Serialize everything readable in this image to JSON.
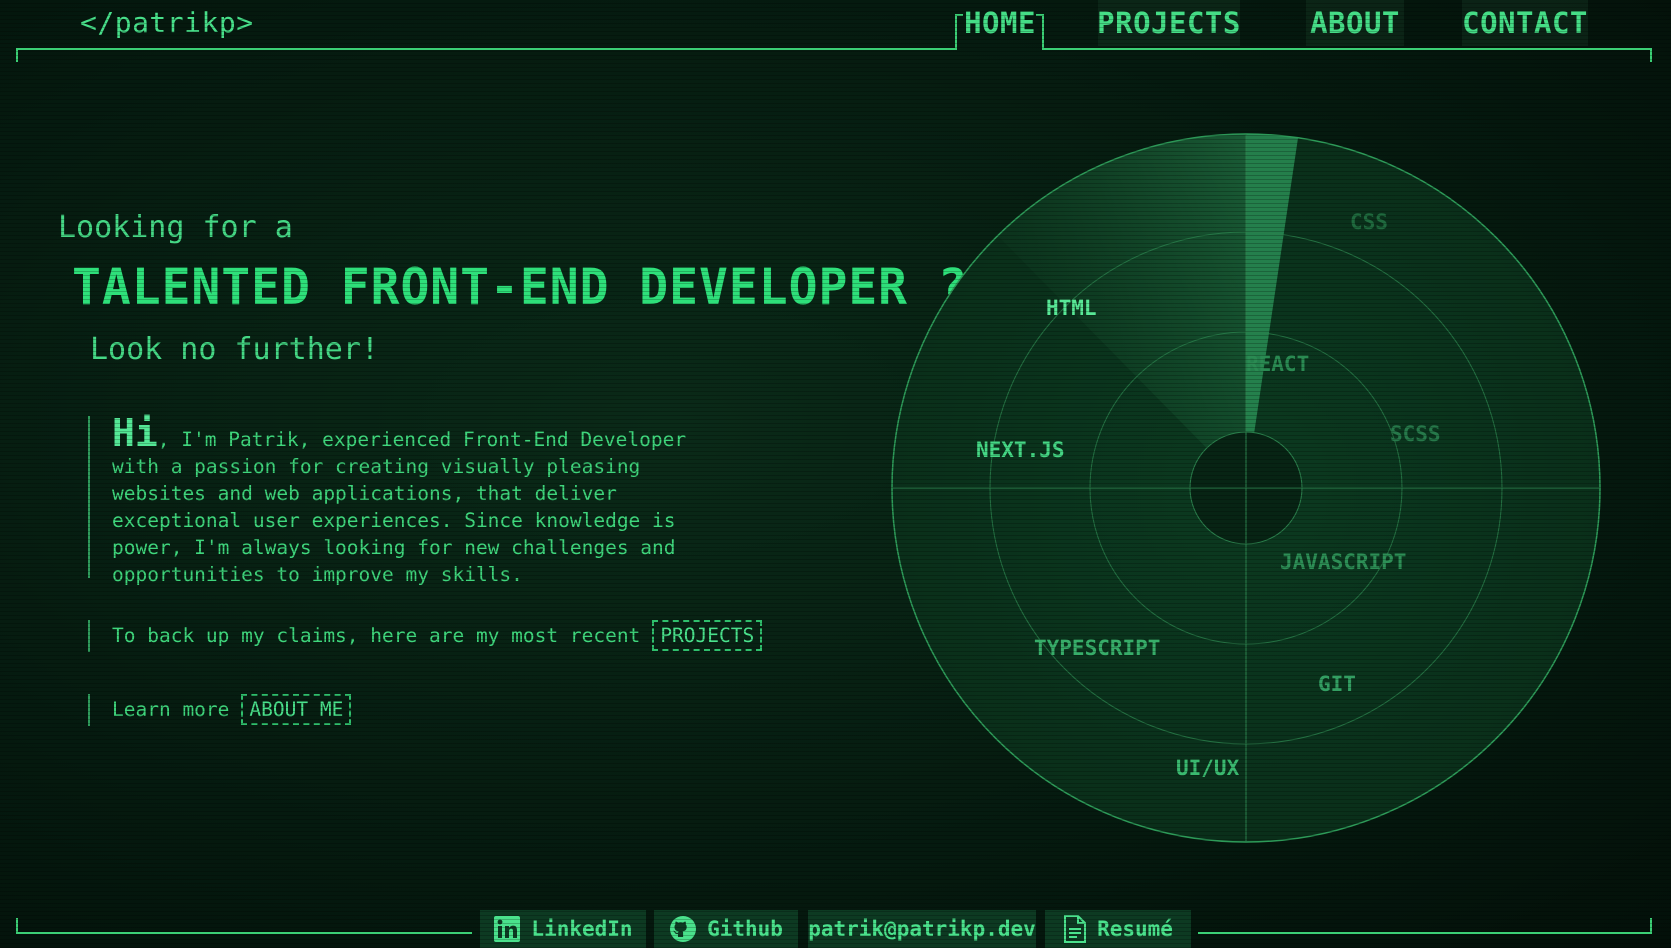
{
  "header": {
    "logo": "</patrikp>",
    "nav": [
      {
        "label": "HOME",
        "active": true
      },
      {
        "label": "PROJECTS",
        "active": false
      },
      {
        "label": "ABOUT",
        "active": false
      },
      {
        "label": "CONTACT",
        "active": false
      }
    ]
  },
  "hero": {
    "intro": "Looking for a",
    "headline": "TALENTED FRONT-END DEVELOPER ?",
    "subline": "Look no further!",
    "greeting": "Hi",
    "bio": ", I'm Patrik, experienced Front-End Developer with a passion for creating visually pleasing websites and web applications, that deliver exceptional user experiences. Since knowledge is power, I'm always looking for new challenges and opportunities to improve my skills.",
    "projects_text": "To back up my claims, here are my most recent",
    "projects_button": "PROJECTS",
    "about_text": "Learn more",
    "about_button": "ABOUT ME"
  },
  "radar": {
    "skills": [
      "CSS",
      "HTML",
      "REACT",
      "SCSS",
      "NEXT.JS",
      "JAVASCRIPT",
      "TYPESCRIPT",
      "GIT",
      "UI/UX"
    ]
  },
  "footer": {
    "links": [
      {
        "label": "LinkedIn",
        "icon": "linkedin-icon"
      },
      {
        "label": "Github",
        "icon": "github-icon"
      },
      {
        "label": "patrik@patrikp.dev",
        "icon": ""
      },
      {
        "label": "Resumé",
        "icon": "document-icon"
      }
    ]
  },
  "colors": {
    "background": "#04170e",
    "accent": "#3fd67c",
    "button_bg": "#0d3a22"
  }
}
